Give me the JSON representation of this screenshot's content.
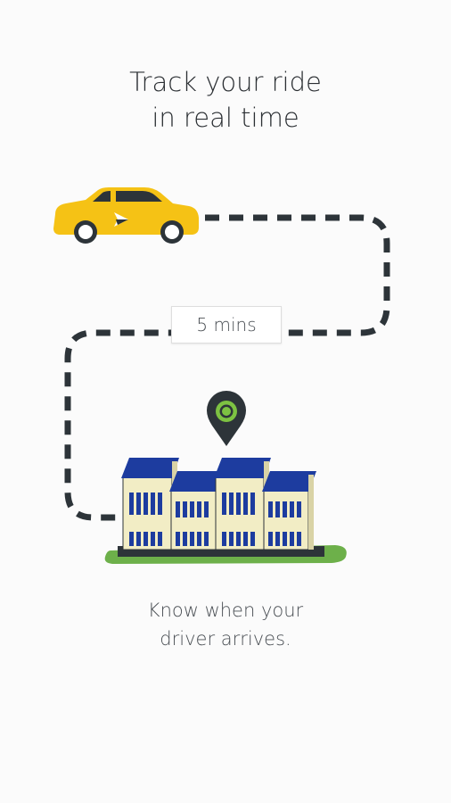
{
  "headline": {
    "line1": "Track your ride",
    "line2": "in real time"
  },
  "eta_badge": {
    "label": "5 mins"
  },
  "caption": {
    "line1": "Know when your",
    "line2": "driver arrives."
  },
  "colors": {
    "car": "#f5c215",
    "route": "#2d3439",
    "pin": "#2d3439",
    "pin_ring": "#7dc242",
    "roof": "#1d3c9f",
    "building": "#f2edc5",
    "grass": "#6db04a"
  },
  "icons": {
    "vehicle": "taxi-car-icon",
    "destination": "location-pin-icon",
    "building": "building-icon"
  }
}
